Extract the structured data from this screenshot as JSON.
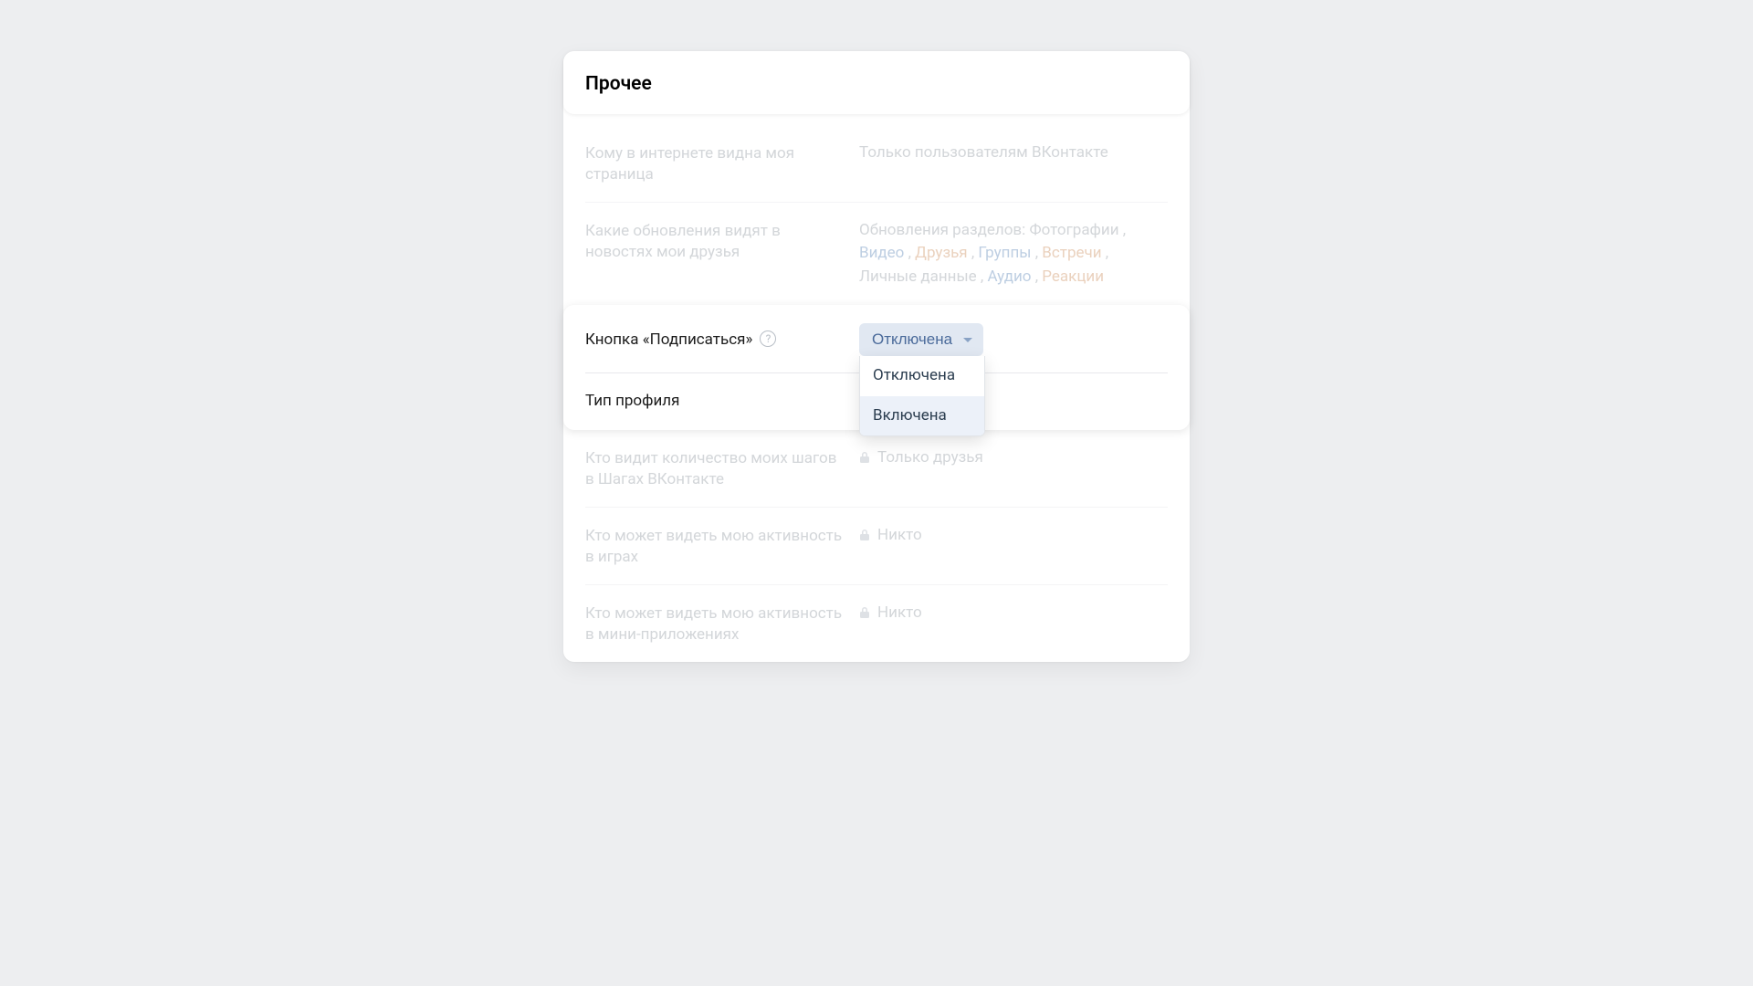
{
  "header": {
    "title": "Прочее"
  },
  "rows": {
    "visibility": {
      "label": "Кому в интернете видна моя страница",
      "value": "Только пользователям ВКонтакте"
    },
    "updates": {
      "label": "Какие обновления видят в новостях мои друзья",
      "prefix": "Обновления разделов:",
      "tags": [
        {
          "text": "Фотографии",
          "style": "plain"
        },
        {
          "text": "Видео",
          "style": "blue"
        },
        {
          "text": "Друзья",
          "style": "orange"
        },
        {
          "text": "Группы",
          "style": "blue"
        },
        {
          "text": "Встречи",
          "style": "orange"
        },
        {
          "text": "Личные данные",
          "style": "plain"
        },
        {
          "text": "Аудио",
          "style": "blue"
        },
        {
          "text": "Реакции",
          "style": "orange"
        }
      ]
    },
    "subscribe_button": {
      "label": "Кнопка «Подписаться»",
      "selected": "Отключена",
      "options": [
        "Отключена",
        "Включена"
      ],
      "hover_index": 1
    },
    "profile_type": {
      "label": "Тип профиля"
    },
    "steps": {
      "label": "Кто видит количество моих шагов в Шагах ВКонтакте",
      "value": "Только друзья",
      "locked": true
    },
    "games_activity": {
      "label": "Кто может видеть мою активность в играх",
      "value": "Никто",
      "locked": true
    },
    "miniapps_activity": {
      "label": "Кто может видеть мою активность в мини-приложениях",
      "value": "Никто",
      "locked": true
    }
  }
}
